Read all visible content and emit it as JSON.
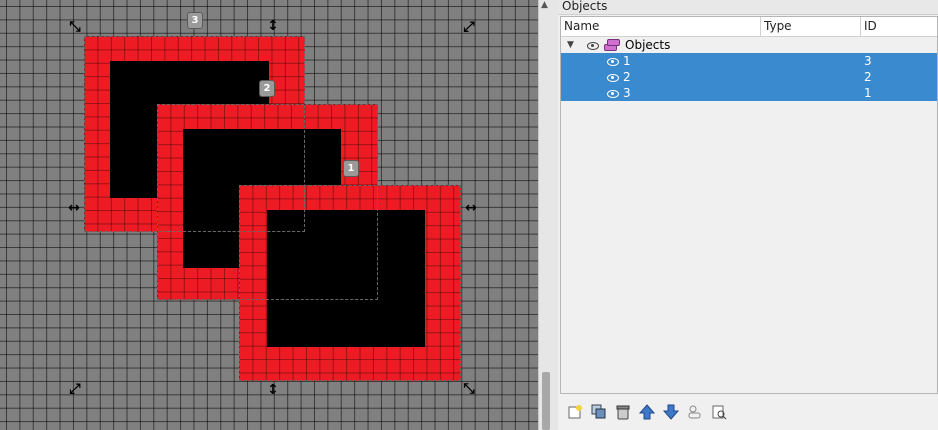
{
  "panel": {
    "title": "Objects",
    "columns": {
      "name": "Name",
      "type": "Type",
      "id": "ID"
    },
    "root": {
      "name": "Objects"
    },
    "items": [
      {
        "name": "1",
        "type": "",
        "id": "3"
      },
      {
        "name": "2",
        "type": "",
        "id": "2"
      },
      {
        "name": "3",
        "type": "",
        "id": "1"
      }
    ]
  },
  "canvas": {
    "badges": [
      "3",
      "2",
      "1"
    ]
  },
  "toolbar": {
    "icons": [
      "new-object-icon",
      "duplicate-icon",
      "delete-icon",
      "move-up-icon",
      "move-down-icon",
      "group-icon",
      "properties-icon"
    ]
  },
  "colors": {
    "object_fill": "#ed1c24",
    "object_inner": "#000000",
    "canvas_bg": "#808080",
    "selection": "#3a8ad0"
  }
}
